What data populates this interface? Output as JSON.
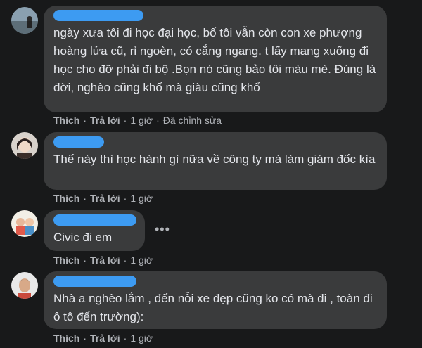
{
  "comments": [
    {
      "text": "ngày xưa tôi đi học đại học, bố tôi vẫn còn con xe phượng hoàng lửa cũ, rỉ ngoèn, có cắng ngang. t lấy mang xuống đi học cho đỡ phải đi bộ .Bọn nó cũng bảo tôi màu mè. Đúng là đời, nghèo cũng khổ mà giàu cũng khổ",
      "like": "Thích",
      "reply": "Trả lời",
      "time": "1 giờ",
      "edited": "Đã chỉnh sửa"
    },
    {
      "text": "Thế này thì học hành gì nữa về công ty mà làm giám đốc kìa",
      "like": "Thích",
      "reply": "Trả lời",
      "time": "1 giờ"
    },
    {
      "text": "Civic đi em",
      "like": "Thích",
      "reply": "Trả lời",
      "time": "1 giờ",
      "more": "•••"
    },
    {
      "text": "Nhà a nghèo lắm , đến nỗi xe đẹp cũng ko có mà đi , toàn đi ô tô đến trường):",
      "like": "Thích",
      "reply": "Trả lời",
      "time": "1 giờ"
    }
  ],
  "separator": "·",
  "colors": {
    "background": "#18191a",
    "bubble": "#3a3b3c",
    "redacted_name": "#3d9bf2",
    "text": "#e4e6eb",
    "meta": "#b0b3b8"
  }
}
